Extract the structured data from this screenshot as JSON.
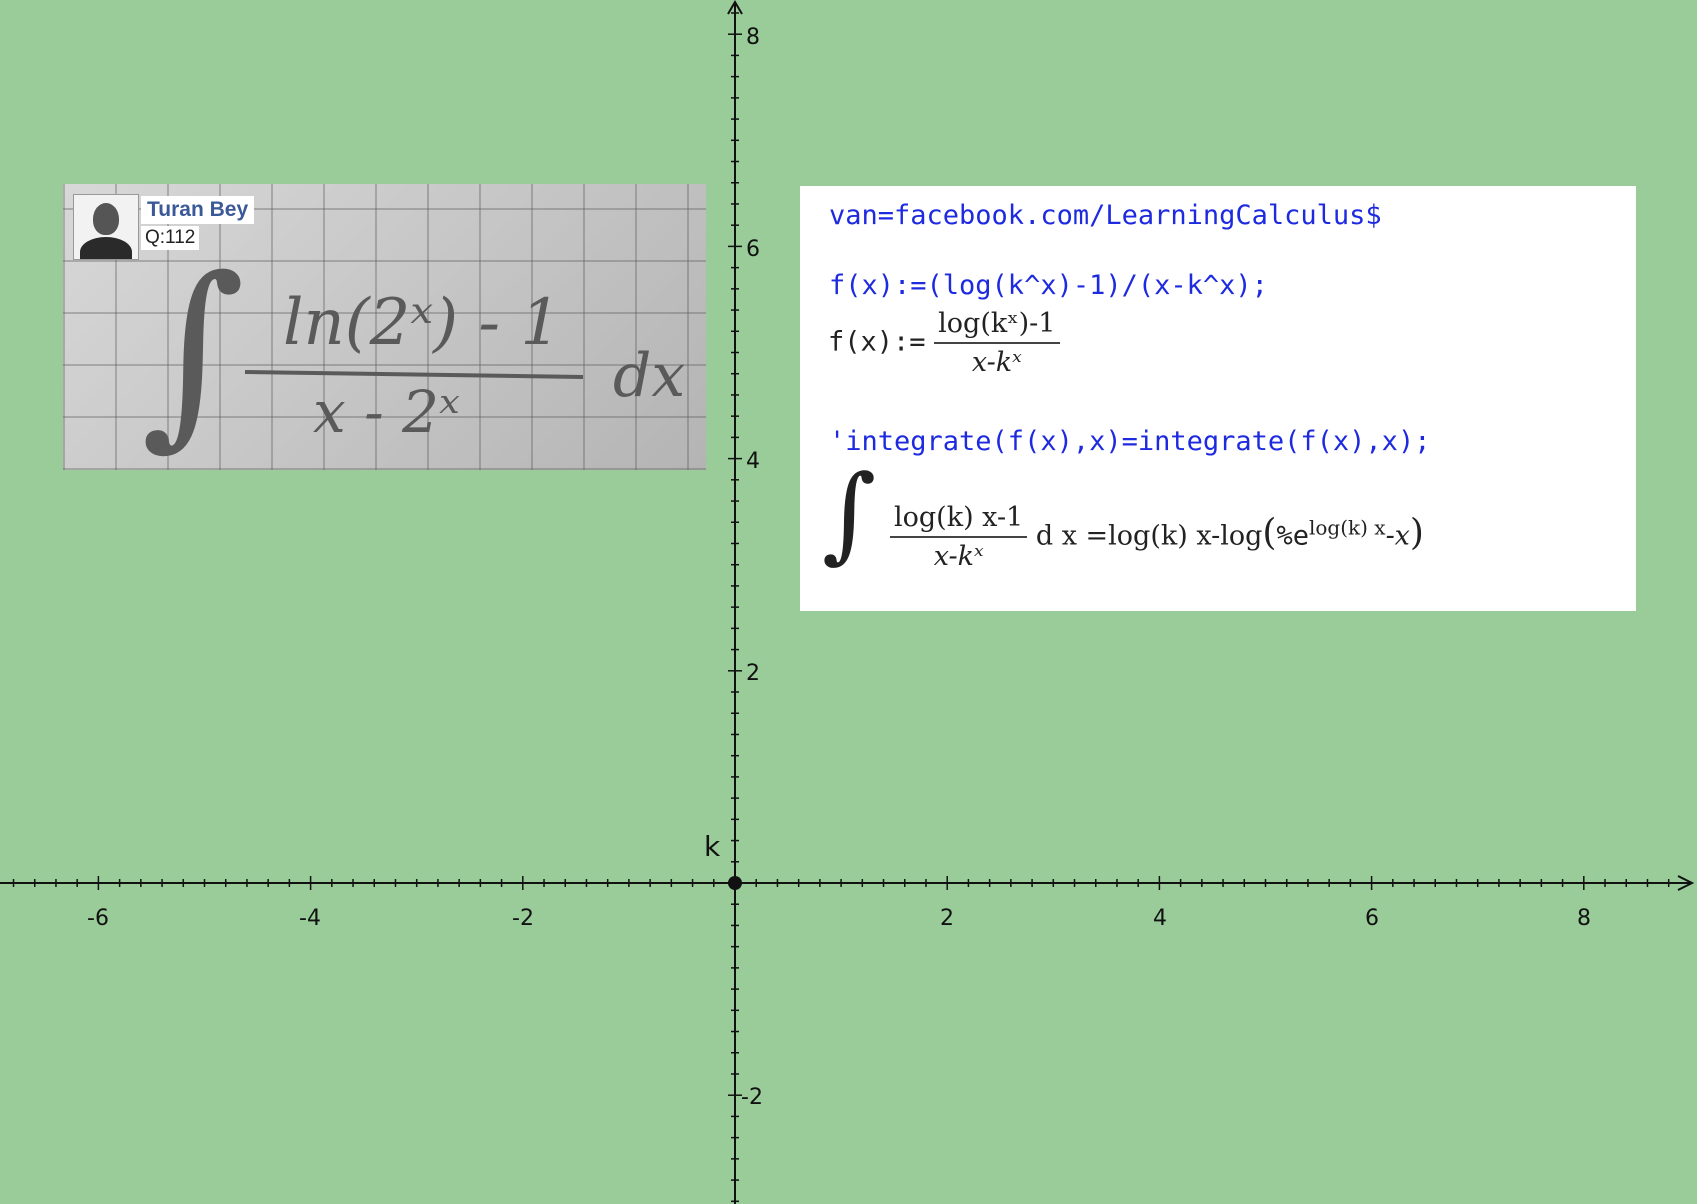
{
  "axes": {
    "x_name": "k",
    "x_ticks": [
      "-6",
      "-4",
      "-2",
      "2",
      "4",
      "6",
      "8"
    ],
    "y_ticks": [
      "8",
      "6",
      "4",
      "2",
      "-2"
    ]
  },
  "photo": {
    "user_name": "Turan Bey",
    "question_id": "Q:112",
    "handwritten": {
      "integral_sign": "∫",
      "numerator": "ln(2ˣ) - 1",
      "denominator": "x - 2ˣ",
      "differential": "dx"
    }
  },
  "maxima": {
    "input1": "van=facebook.com/LearningCalculus$",
    "input2": "f(x):=(log(k^x)-1)/(x-k^x);",
    "out2_lhs": "f(x):=",
    "out2_num": "log(kˣ)-1",
    "out2_den": "x-kˣ",
    "input3": "'integrate(f(x),x)=integrate(f(x),x);",
    "out3_int": "∫",
    "out3_num": "log(k) x-1",
    "out3_den": "x-kˣ",
    "out3_dx": "d x",
    "out3_rhs_a": "=log(k) x-log",
    "out3_rhs_open": "(",
    "out3_pe": "%e",
    "out3_exp": "log(k) x",
    "out3_rhs_b": "-x",
    "out3_rhs_close": ")"
  }
}
